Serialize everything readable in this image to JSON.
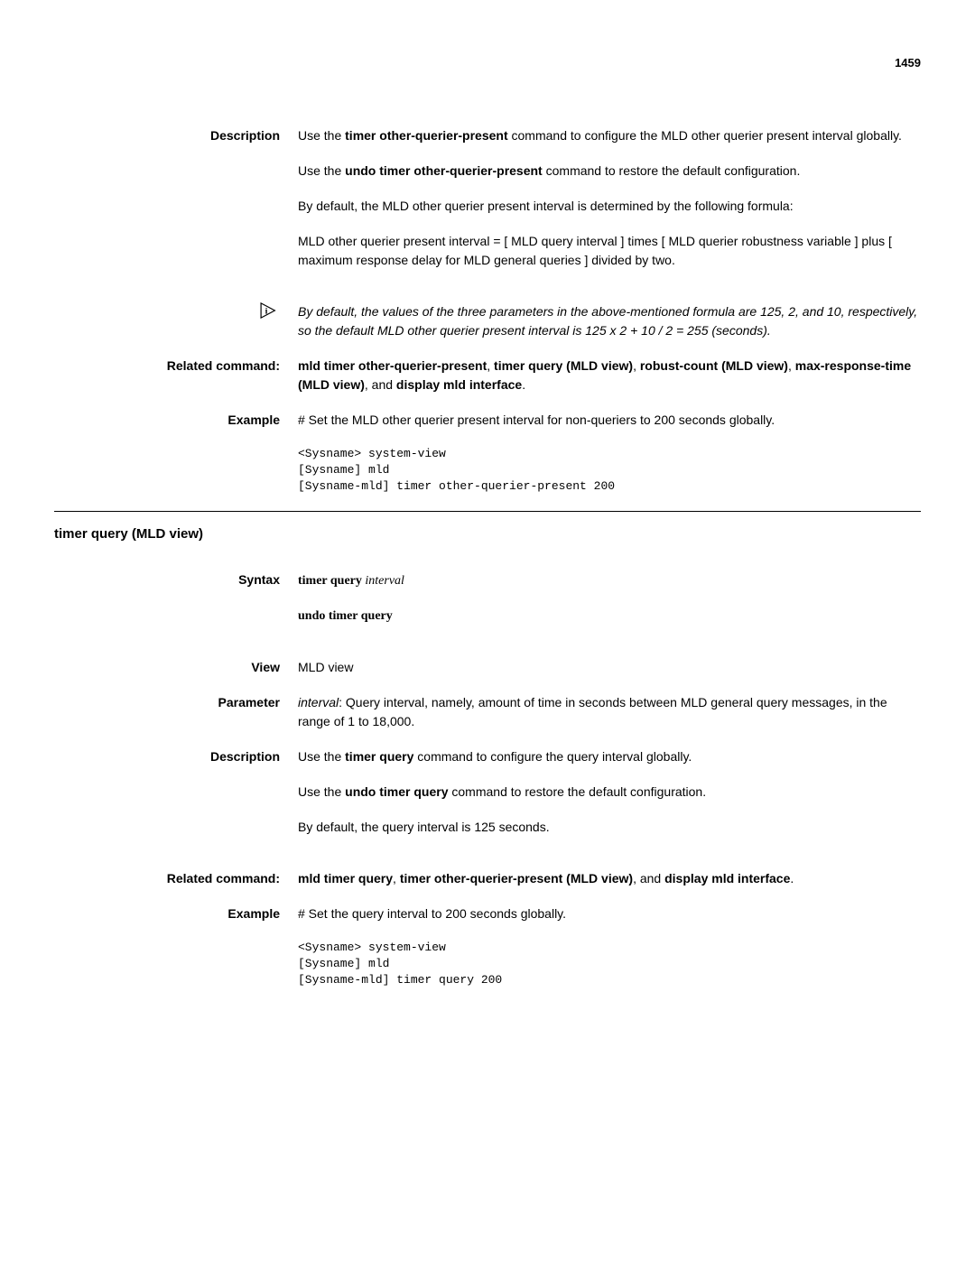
{
  "page_number": "1459",
  "sec1": {
    "description_label": "Description",
    "desc_p1_a": "Use the ",
    "desc_p1_b": "timer other-querier-present",
    "desc_p1_c": " command to configure the MLD other querier present interval globally.",
    "desc_p2_a": "Use the ",
    "desc_p2_b": "undo timer other-querier-present",
    "desc_p2_c": " command to restore the default configuration.",
    "desc_p3": "By default, the MLD other querier present interval is determined by the following formula:",
    "desc_p4": "MLD other querier present interval = [ MLD query interval ] times [ MLD querier robustness variable ] plus [ maximum response delay for MLD general queries ] divided by two.",
    "note": "By default, the values of the three parameters in the above-mentioned formula are 125, 2, and 10, respectively, so the default MLD other querier present interval is 125 x 2 + 10 / 2 = 255 (seconds).",
    "related_label": "Related command:",
    "related_a": "mld timer other-querier-present",
    "related_b": ", ",
    "related_c": "timer query (MLD view)",
    "related_d": ", ",
    "related_e": "robust-count (MLD view)",
    "related_f": ", ",
    "related_g": "max-response-time (MLD view)",
    "related_h": ", and ",
    "related_i": "display mld interface",
    "related_j": ".",
    "example_label": "Example",
    "example_text": "# Set the MLD other querier present interval for non-queriers to 200 seconds globally.",
    "example_code": "<Sysname> system-view\n[Sysname] mld\n[Sysname-mld] timer other-querier-present 200"
  },
  "sec2": {
    "title": "timer query (MLD view)",
    "syntax_label": "Syntax",
    "syntax_a": "timer query ",
    "syntax_b": "interval",
    "syntax_undo": "undo timer query",
    "view_label": "View",
    "view_text": "MLD view",
    "param_label": "Parameter",
    "param_a": "interval",
    "param_b": ": Query interval, namely, amount of time in seconds between MLD general query messages, in the range of 1 to 18,000.",
    "desc_label": "Description",
    "desc_p1_a": "Use the ",
    "desc_p1_b": "timer query",
    "desc_p1_c": " command to configure the query interval globally.",
    "desc_p2_a": "Use the ",
    "desc_p2_b": "undo timer query",
    "desc_p2_c": " command to restore the default configuration.",
    "desc_p3": "By default, the query interval is 125 seconds.",
    "related_label": "Related command:",
    "related_a": "mld timer query",
    "related_b": ", ",
    "related_c": "timer other-querier-present (MLD view)",
    "related_d": ", and ",
    "related_e": "display mld interface",
    "related_f": ".",
    "example_label": "Example",
    "example_text": "# Set the query interval to 200 seconds globally.",
    "example_code": "<Sysname> system-view\n[Sysname] mld\n[Sysname-mld] timer query 200"
  }
}
